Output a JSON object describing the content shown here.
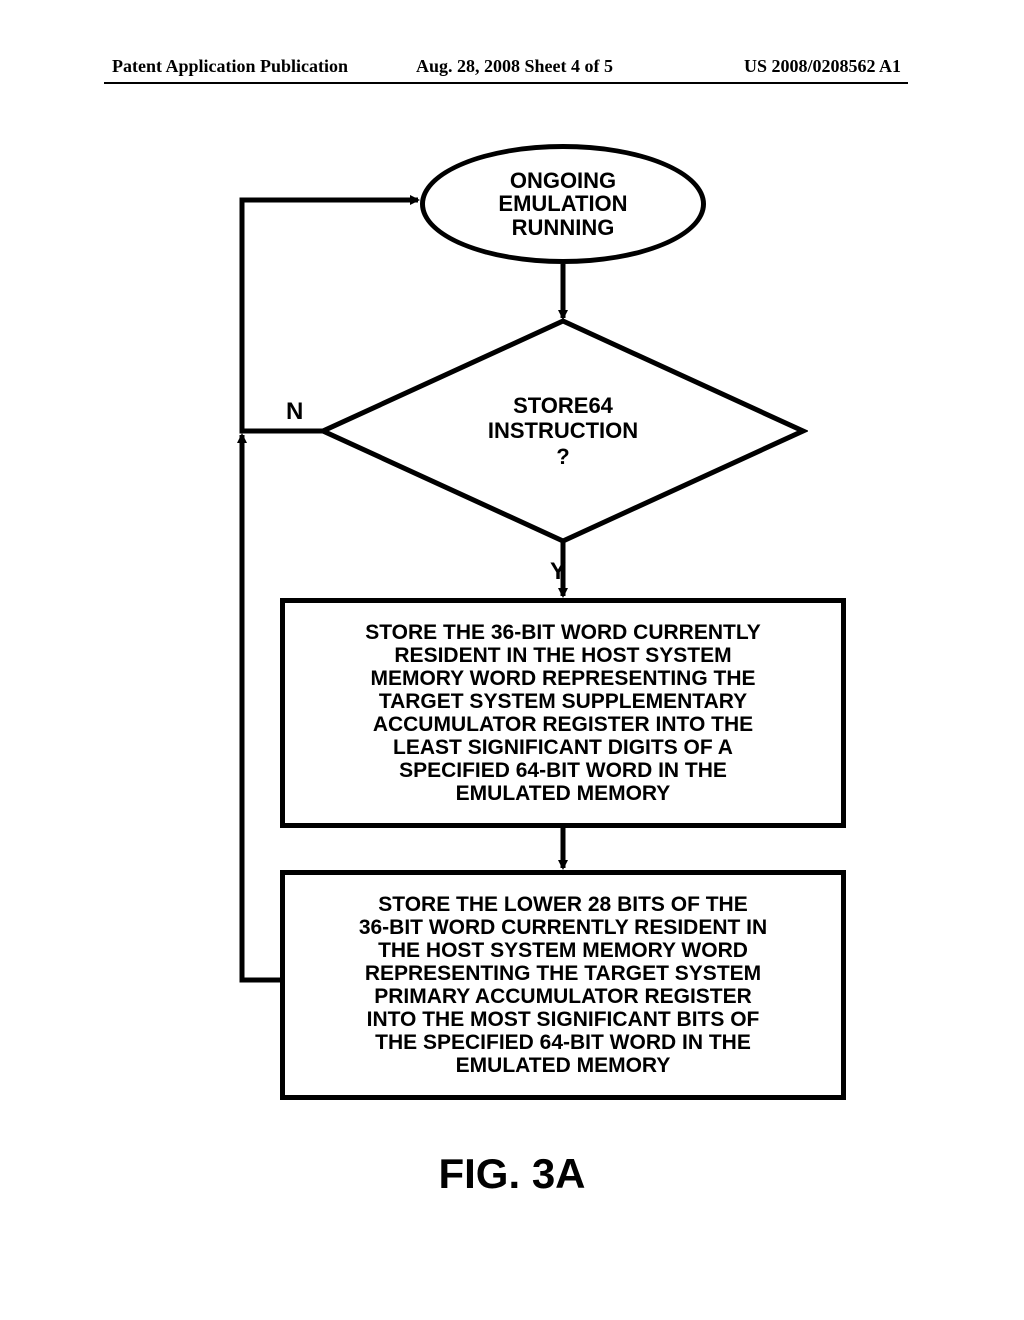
{
  "header": {
    "left": "Patent Application Publication",
    "center": "Aug. 28, 2008  Sheet 4 of 5",
    "right": "US 2008/0208562 A1"
  },
  "flow": {
    "start": "ONGOING\nEMULATION\nRUNNING",
    "decision": "STORE64\nINSTRUCTION\n?",
    "branch_no": "N",
    "branch_yes": "Y",
    "process1": "STORE THE 36-BIT WORD CURRENTLY\nRESIDENT IN THE HOST SYSTEM\nMEMORY WORD REPRESENTING THE\nTARGET SYSTEM SUPPLEMENTARY\nACCUMULATOR REGISTER INTO THE\nLEAST SIGNIFICANT DIGITS OF A\nSPECIFIED 64-BIT WORD IN THE\nEMULATED MEMORY",
    "process2": "STORE THE LOWER 28 BITS OF THE\n36-BIT WORD CURRENTLY RESIDENT IN\nTHE HOST SYSTEM  MEMORY WORD\nREPRESENTING THE TARGET SYSTEM\nPRIMARY ACCUMULATOR REGISTER\nINTO THE MOST SIGNIFICANT BITS OF\nTHE SPECIFIED 64-BIT WORD IN THE\nEMULATED MEMORY"
  },
  "figure_label": "FIG. 3A"
}
